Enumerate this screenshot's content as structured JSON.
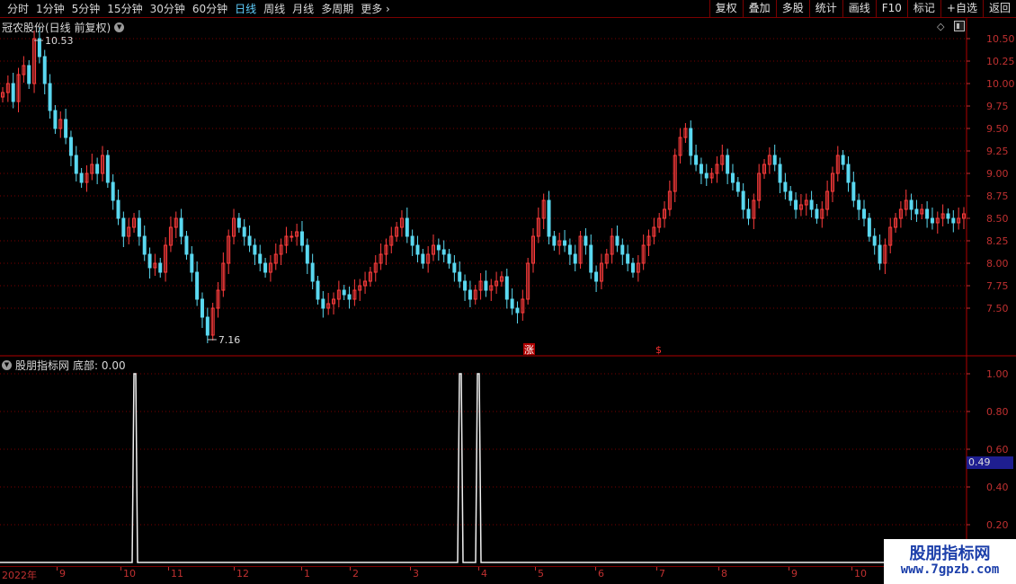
{
  "toolbar": {
    "periods": [
      "分时",
      "1分钟",
      "5分钟",
      "15分钟",
      "30分钟",
      "60分钟",
      "日线",
      "周线",
      "月线",
      "多周期",
      "更多"
    ],
    "active_period": "日线",
    "buttons": [
      "复权",
      "叠加",
      "多股",
      "统计",
      "画线",
      "F10",
      "标记",
      "+自选",
      "返回"
    ]
  },
  "main_chart": {
    "title": "冠农股份(日线 前复权)",
    "high_label": "10.53",
    "low_label": "7.16",
    "marker_zhang": "涨",
    "marker_s": "$",
    "price_axis": [
      "10.50",
      "10.25",
      "10.00",
      "9.75",
      "9.50",
      "9.25",
      "9.00",
      "8.75",
      "8.50",
      "8.25",
      "8.00",
      "7.75",
      "7.50"
    ],
    "colors": {
      "up": "#ff3c3c",
      "down": "#5ad8f0",
      "grid": "#7a0000"
    }
  },
  "indicator": {
    "title": "股朋指标网",
    "series_label": "底部: 0.00",
    "value_axis": [
      "1.00",
      "0.80",
      "0.60",
      "0.40",
      "0.20"
    ],
    "current_value": "0.49"
  },
  "date_axis": [
    "2022年",
    "9",
    "10",
    "11",
    "12",
    "1",
    "2",
    "3",
    "4",
    "5",
    "6",
    "7",
    "8",
    "9",
    "10"
  ],
  "watermark": {
    "title": "股朋指标网",
    "url": "www.7gpzb.com"
  },
  "chart_data": {
    "type": "candlestick",
    "title": "冠农股份(日线 前复权)",
    "ylim": [
      7.0,
      10.7
    ],
    "high": 10.53,
    "low": 7.16,
    "close_series": [
      9.9,
      10.0,
      9.8,
      10.1,
      10.2,
      10.0,
      10.5,
      10.3,
      10.0,
      9.7,
      9.5,
      9.6,
      9.4,
      9.2,
      9.0,
      8.9,
      9.0,
      9.1,
      9.0,
      9.2,
      8.9,
      8.7,
      8.5,
      8.3,
      8.4,
      8.5,
      8.3,
      8.1,
      7.95,
      8.0,
      7.9,
      8.2,
      8.4,
      8.5,
      8.3,
      8.1,
      7.9,
      7.6,
      7.4,
      7.2,
      7.5,
      7.7,
      8.0,
      8.3,
      8.5,
      8.4,
      8.3,
      8.2,
      8.1,
      8.0,
      7.9,
      8.0,
      8.1,
      8.2,
      8.3,
      8.3,
      8.35,
      8.2,
      8.0,
      7.8,
      7.6,
      7.5,
      7.55,
      7.6,
      7.7,
      7.65,
      7.6,
      7.7,
      7.75,
      7.8,
      7.9,
      8.0,
      8.1,
      8.2,
      8.3,
      8.4,
      8.5,
      8.3,
      8.2,
      8.1,
      8.0,
      8.1,
      8.2,
      8.15,
      8.1,
      8.0,
      7.9,
      7.8,
      7.7,
      7.6,
      7.7,
      7.8,
      7.7,
      7.75,
      7.8,
      7.85,
      7.6,
      7.5,
      7.45,
      7.6,
      8.0,
      8.3,
      8.5,
      8.7,
      8.3,
      8.2,
      8.25,
      8.2,
      8.1,
      8.0,
      8.3,
      8.2,
      7.9,
      7.8,
      8.0,
      8.1,
      8.3,
      8.2,
      8.1,
      8.0,
      7.9,
      8.0,
      8.2,
      8.3,
      8.4,
      8.5,
      8.6,
      8.8,
      9.2,
      9.4,
      9.5,
      9.2,
      9.1,
      9.0,
      8.95,
      9.0,
      9.1,
      9.2,
      9.0,
      8.9,
      8.8,
      8.6,
      8.5,
      8.7,
      9.0,
      9.1,
      9.2,
      9.1,
      8.9,
      8.8,
      8.7,
      8.6,
      8.65,
      8.7,
      8.6,
      8.5,
      8.6,
      8.8,
      9.0,
      9.2,
      9.1,
      8.9,
      8.7,
      8.6,
      8.5,
      8.3,
      8.2,
      8.0,
      8.2,
      8.4,
      8.5,
      8.6,
      8.7,
      8.6,
      8.55,
      8.6,
      8.5,
      8.45,
      8.5,
      8.55,
      8.5,
      8.45,
      8.5,
      8.55
    ],
    "indicator_series": {
      "name": "底部",
      "values_at_spikes": [
        1.0,
        1.0,
        1.0
      ],
      "ylim": [
        0,
        1.05
      ]
    }
  }
}
